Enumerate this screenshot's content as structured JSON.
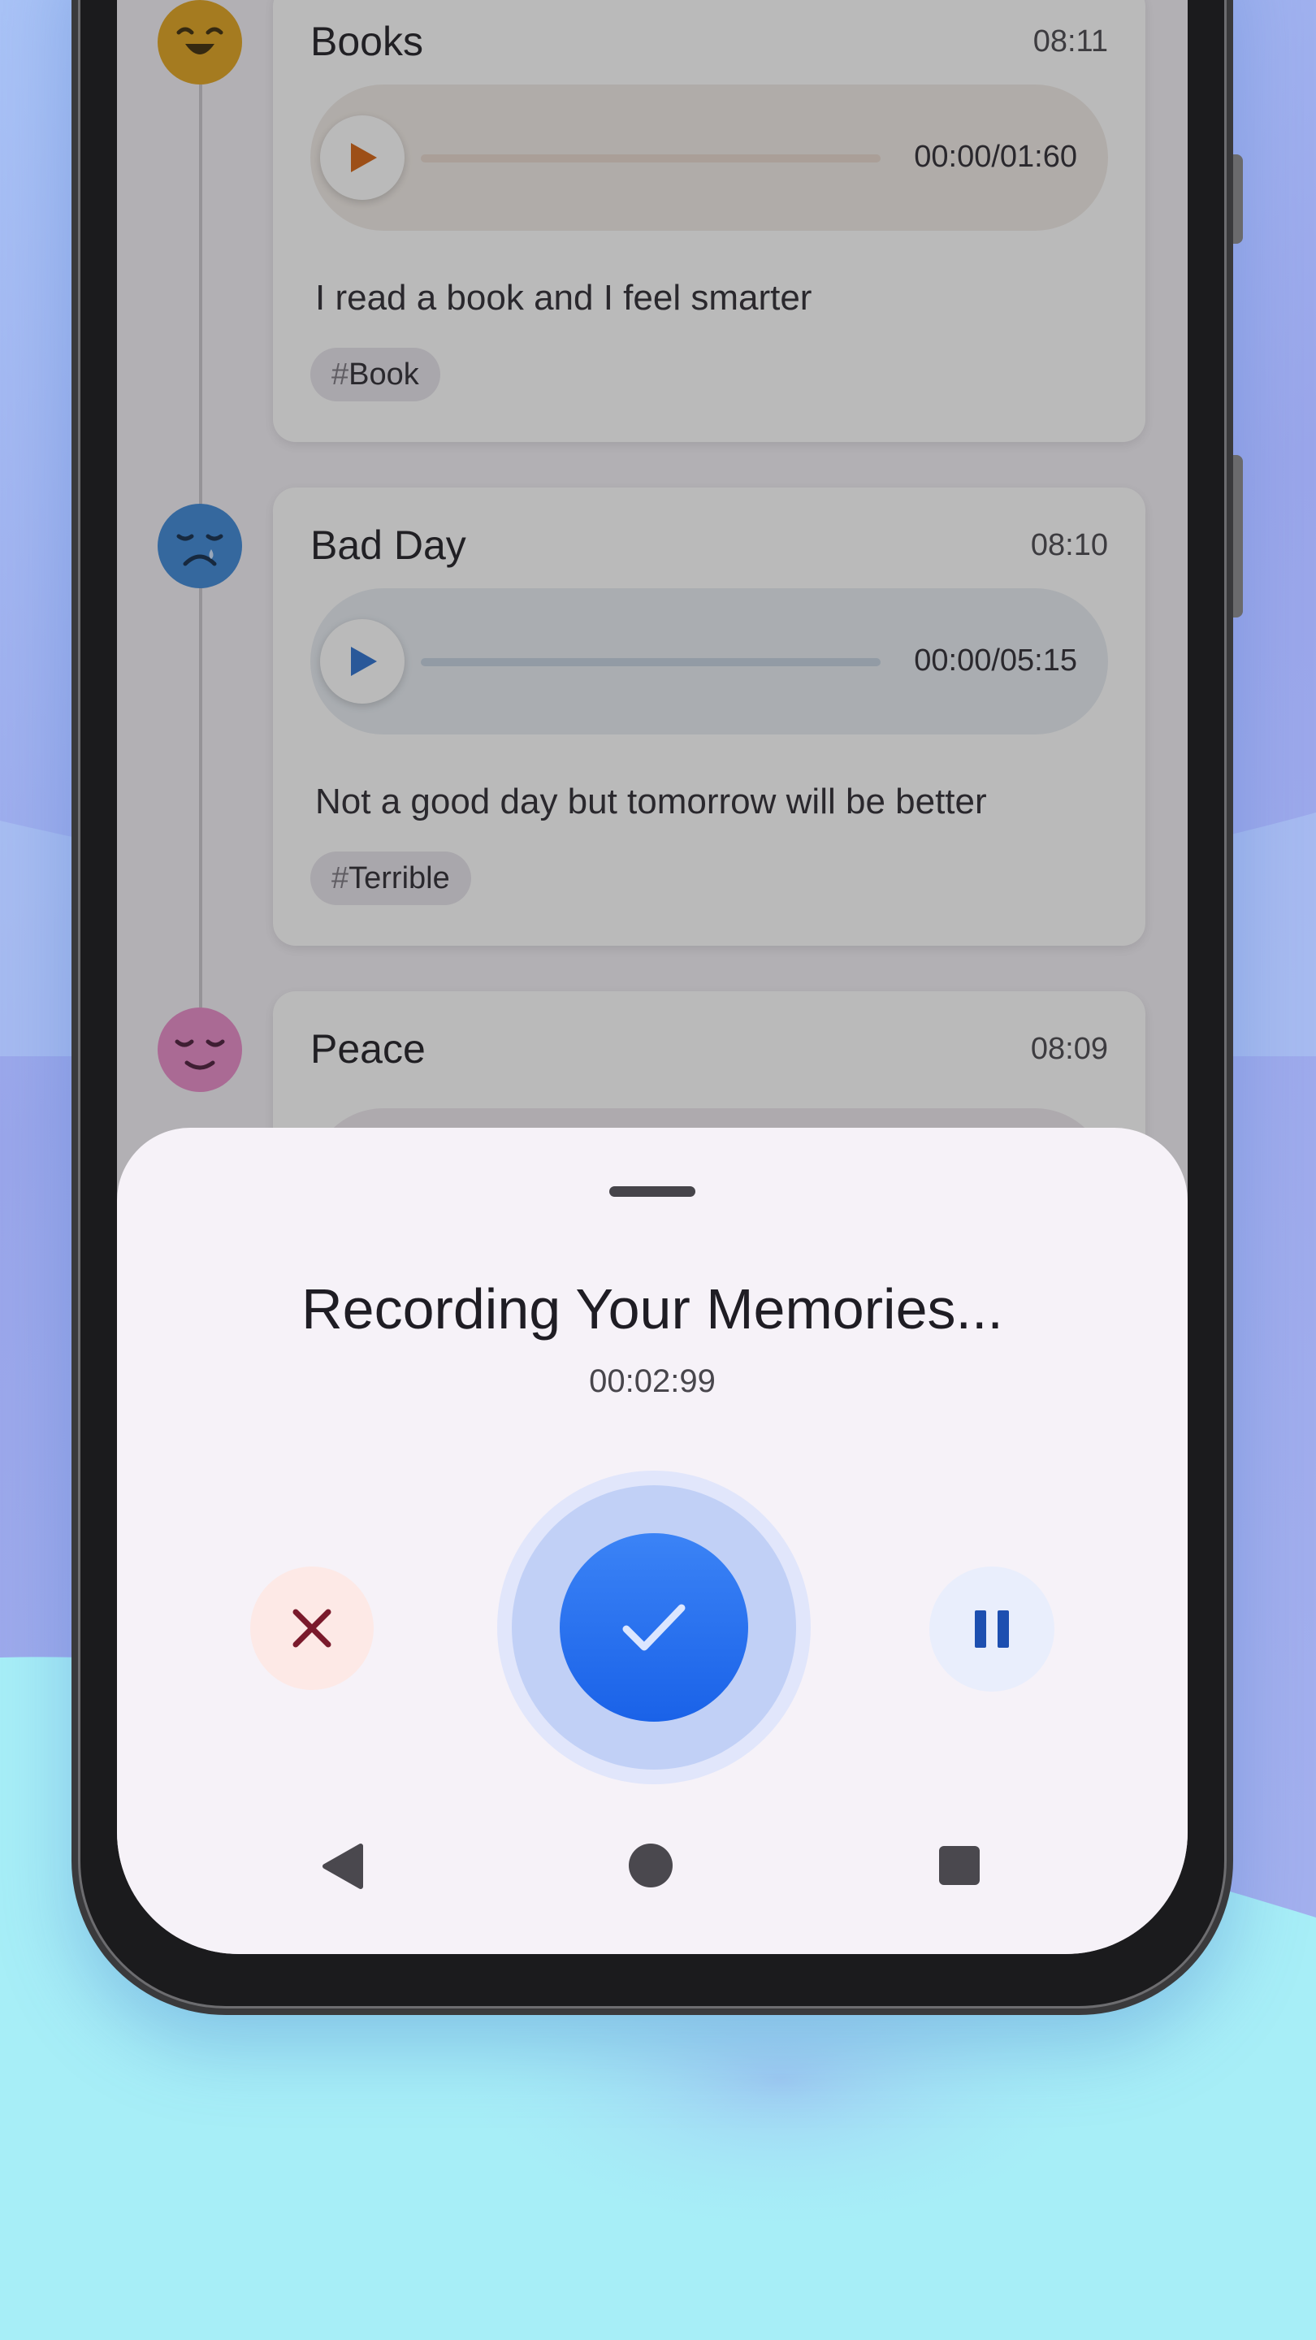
{
  "entries": [
    {
      "title": "Books",
      "time": "08:11",
      "mood_icon": "laughing-face-icon",
      "mood_color": "#e0a31d",
      "accent_color": "#d4620f",
      "player_bg": "#f1ebe6",
      "track_color": "#e7d8cd",
      "duration": "00:00/01:60",
      "description": "I read a book and I feel smarter",
      "tag": {
        "hash": "#",
        "label": "Book"
      }
    },
    {
      "title": "Bad Day",
      "time": "08:10",
      "mood_icon": "crying-face-icon",
      "mood_color": "#3b86d6",
      "accent_color": "#2a6fcf",
      "player_bg": "#e7ecf2",
      "track_color": "#c5d2e0",
      "duration": "00:00/05:15",
      "description": "Not a good day but tomorrow will be better",
      "tag": {
        "hash": "#",
        "label": "Terrible"
      }
    },
    {
      "title": "Peace",
      "time": "08:09",
      "mood_icon": "peaceful-face-icon",
      "mood_color": "#e88ac8"
    }
  ],
  "recording": {
    "title": "Recording Your Memories...",
    "timer": "00:02:99",
    "cancel_icon": "close-icon",
    "confirm_icon": "checkmark-icon",
    "pause_icon": "pause-icon",
    "cancel_color": "#7a1a2c",
    "confirm_color": "#1f68ee",
    "pause_color": "#1d4fb0"
  },
  "navbar": {
    "back_icon": "back-triangle-icon",
    "home_icon": "home-circle-icon",
    "recents_icon": "recents-square-icon"
  }
}
